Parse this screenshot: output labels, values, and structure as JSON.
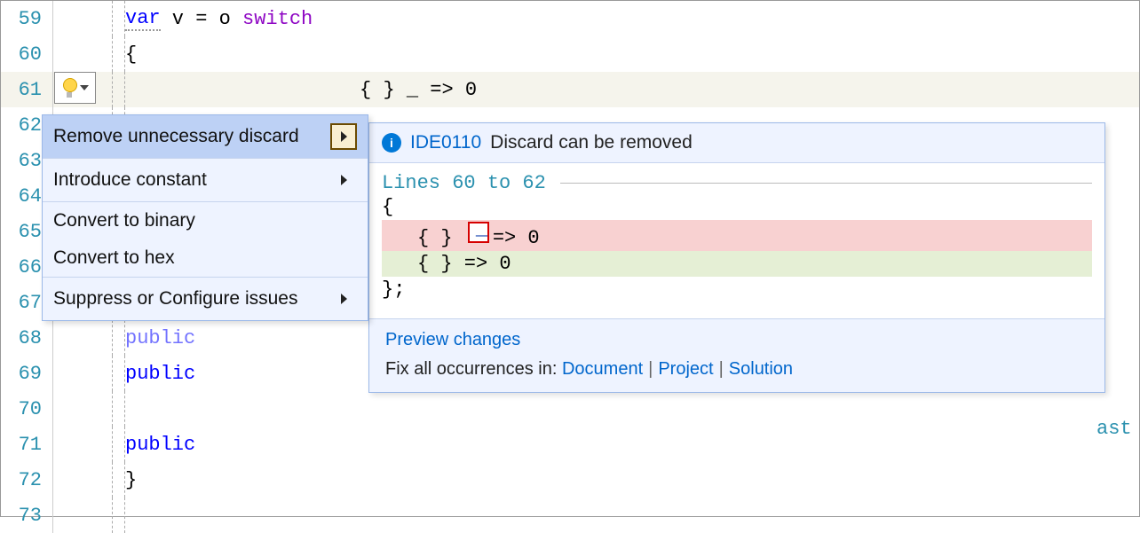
{
  "code": {
    "lines": [
      {
        "num": "59",
        "indent": "                ",
        "tokens": [
          {
            "t": "var",
            "c": "kw-var"
          },
          {
            "t": " v = o "
          },
          {
            "t": "switch",
            "c": "kw-switch"
          }
        ]
      },
      {
        "num": "60",
        "indent": "                ",
        "tokens": [
          {
            "t": "{",
            "c": "brace"
          }
        ]
      },
      {
        "num": "61",
        "indent": "                    ",
        "tokens": [
          {
            "t": "{ } _ => 0"
          }
        ],
        "current": true
      },
      {
        "num": "62",
        "indent": "                "
      },
      {
        "num": "63",
        "indent": ""
      },
      {
        "num": "64",
        "indent": ""
      },
      {
        "num": "65",
        "indent": ""
      },
      {
        "num": "66",
        "indent": ""
      },
      {
        "num": "67",
        "indent": ""
      },
      {
        "num": "68",
        "indent": "                ",
        "public_gray": "public"
      },
      {
        "num": "69",
        "indent": "                ",
        "public": "public"
      },
      {
        "num": "70",
        "indent": ""
      },
      {
        "num": "71",
        "indent": "                ",
        "public": "public"
      },
      {
        "num": "72",
        "indent": "            ",
        "tokens": [
          {
            "t": "}",
            "c": "brace"
          }
        ]
      },
      {
        "num": "73",
        "indent": ""
      }
    ],
    "trailing_class": "ast"
  },
  "quick_actions": {
    "items": [
      {
        "label": "Remove unnecessary discard",
        "submenu": true,
        "selected": true
      },
      {
        "label": "Introduce constant",
        "submenu": true,
        "sep": true
      },
      {
        "label": "Convert to binary",
        "sep": true
      },
      {
        "label": "Convert to hex"
      },
      {
        "label": "Suppress or Configure issues",
        "submenu": true,
        "sep": true
      }
    ]
  },
  "preview": {
    "diag_id": "IDE0110",
    "diag_msg": "Discard can be removed",
    "lines_label": "Lines 60 to 62",
    "diff": {
      "context_before": "{",
      "removed": "{ }  => 0",
      "added": "{ } => 0",
      "context_after": "};"
    },
    "footer": {
      "preview_changes": "Preview changes",
      "fix_label": "Fix all occurrences in:",
      "scopes": [
        "Document",
        "Project",
        "Solution"
      ]
    }
  }
}
